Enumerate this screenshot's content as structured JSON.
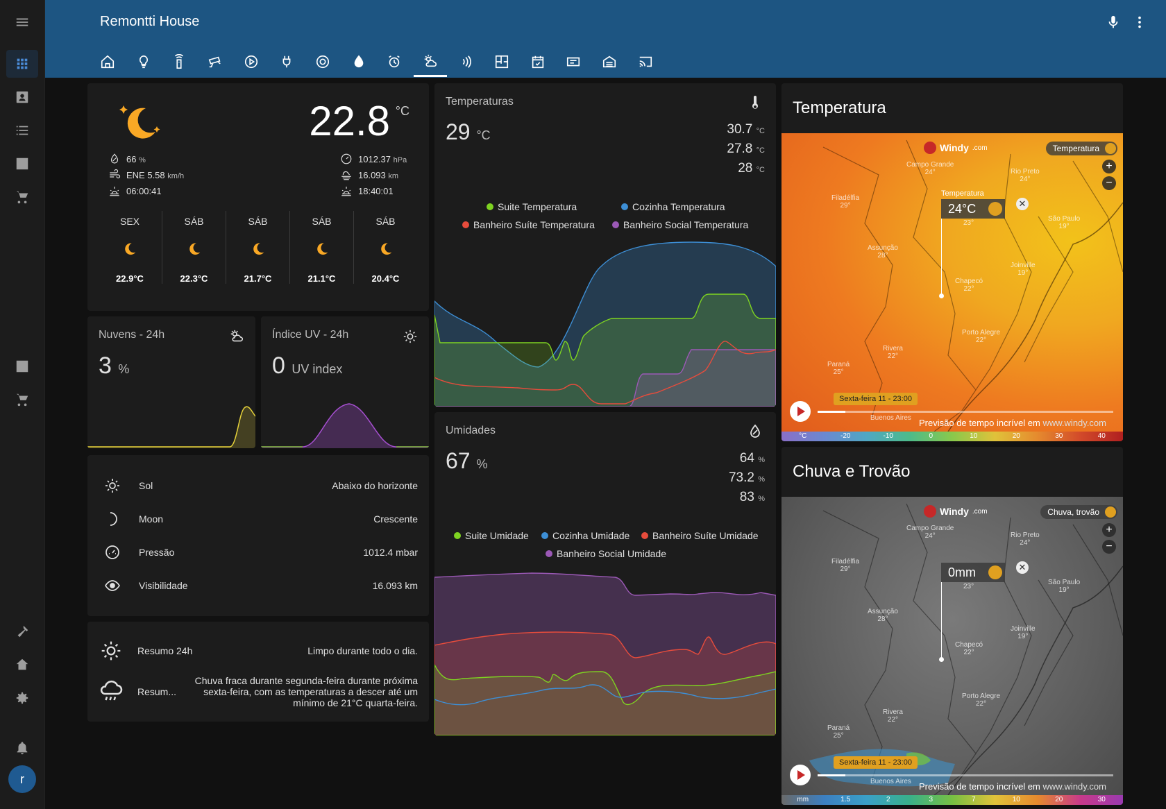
{
  "app": {
    "title": "Remontti House",
    "user_initial": "r"
  },
  "sidebar": {
    "items": [
      {
        "icon": "menu-icon"
      },
      {
        "icon": "dashboard-icon"
      },
      {
        "icon": "contact-icon"
      },
      {
        "icon": "list-icon"
      },
      {
        "icon": "chart-icon"
      },
      {
        "icon": "cart-icon"
      },
      {
        "icon": "chart-icon"
      },
      {
        "icon": "cart-icon"
      },
      {
        "icon": "hammer-icon"
      },
      {
        "icon": "home-icon"
      },
      {
        "icon": "gear-icon"
      },
      {
        "icon": "bell-icon"
      }
    ]
  },
  "header": {
    "tabs": [
      "home-tab",
      "lightbulb-tab",
      "remote-tab",
      "cctv-tab",
      "play-tab",
      "plug-tab",
      "robot-vacuum-tab",
      "water-tab",
      "alarm-tab",
      "weather-tab",
      "signal-tab",
      "floorplan-tab",
      "calendar-tab",
      "media-tab",
      "garage-tab",
      "cast-tab"
    ],
    "active_tab": 9
  },
  "weather": {
    "temperature": "22.8",
    "temp_unit": "°C",
    "humidity": "66",
    "humidity_unit": "%",
    "wind": "ENE 5.58",
    "wind_unit": "km/h",
    "sunrise": "06:00:41",
    "pressure": "1012.37",
    "pressure_unit": "hPa",
    "visibility": "16.093",
    "visibility_unit": "km",
    "sunset": "18:40:01",
    "forecast": [
      {
        "day": "SEX",
        "temp": "22.9°C"
      },
      {
        "day": "SÁB",
        "temp": "22.3°C"
      },
      {
        "day": "SÁB",
        "temp": "21.7°C"
      },
      {
        "day": "SÁB",
        "temp": "21.1°C"
      },
      {
        "day": "SÁB",
        "temp": "20.4°C"
      }
    ]
  },
  "clouds": {
    "title": "Nuvens - 24h",
    "value": "3",
    "unit": "%",
    "color": "#e6d23a"
  },
  "uv": {
    "title": "Índice UV - 24h",
    "value": "0",
    "unit": "UV index",
    "color": "#a64fd1"
  },
  "entities": [
    {
      "name": "Sol",
      "value": "Abaixo do horizonte",
      "icon": "sun-icon"
    },
    {
      "name": "Moon",
      "value": "Crescente",
      "icon": "moon-icon"
    },
    {
      "name": "Pressão",
      "value": "1012.4 mbar",
      "icon": "gauge-icon"
    },
    {
      "name": "Visibilidade",
      "value": "16.093 km",
      "icon": "eye-icon"
    }
  ],
  "summary": [
    {
      "name": "Resumo 24h",
      "value": "Limpo durante todo o dia.",
      "icon": "weather-sunny-alert-icon"
    },
    {
      "name": "Resum...",
      "value": "Chuva fraca durante segunda-feira durante próxima sexta-feira, com as temperaturas a descer até um mínimo de 21°C quarta-feira.",
      "icon": "weather-rainy-icon"
    }
  ],
  "temperatures": {
    "title": "Temperaturas",
    "value": "29",
    "unit": "°C",
    "side": [
      {
        "v": "30.7",
        "u": "°C"
      },
      {
        "v": "27.8",
        "u": "°C"
      },
      {
        "v": "28",
        "u": "°C"
      }
    ],
    "legend": [
      {
        "name": "Suite Temperatura",
        "color": "#7ed321"
      },
      {
        "name": "Cozinha Temperatura",
        "color": "#3d8fd6"
      },
      {
        "name": "Banheiro Suíte Temperatura",
        "color": "#e74c3c"
      },
      {
        "name": "Banheiro Social Temperatura",
        "color": "#9b59b6"
      }
    ]
  },
  "humidities": {
    "title": "Umidades",
    "value": "67",
    "unit": "%",
    "side": [
      {
        "v": "64",
        "u": "%"
      },
      {
        "v": "73.2",
        "u": "%"
      },
      {
        "v": "83",
        "u": "%"
      }
    ],
    "legend": [
      {
        "name": "Suite Umidade",
        "color": "#7ed321"
      },
      {
        "name": "Cozinha Umidade",
        "color": "#3d8fd6"
      },
      {
        "name": "Banheiro Suíte Umidade",
        "color": "#e74c3c"
      },
      {
        "name": "Banheiro Social Umidade",
        "color": "#9b59b6"
      }
    ]
  },
  "map_temp": {
    "title": "Temperatura",
    "logo": "Windy",
    "logo_suffix": ".com",
    "layer": "Temperatura",
    "popup_label": "Temperatura",
    "popup_value": "24°C",
    "popup_sub": "23°",
    "time": "Sexta-feira 11 - 23:00",
    "credit": "Previsão de tempo incrível em",
    "credit_url": "www.windy.com",
    "scale": [
      "°C",
      "-20",
      "-10",
      "0",
      "10",
      "20",
      "30",
      "40"
    ],
    "cities": [
      {
        "n": "Campo Grande",
        "t": "24°"
      },
      {
        "n": "Rio Preto",
        "t": "24°"
      },
      {
        "n": "Filadélfia",
        "t": "29°"
      },
      {
        "n": "São Paulo",
        "t": "19°"
      },
      {
        "n": "Assunção",
        "t": "28°"
      },
      {
        "n": "Chapecó",
        "t": "22°"
      },
      {
        "n": "Joinville",
        "t": "19°"
      },
      {
        "n": "Porto Alegre",
        "t": "22°"
      },
      {
        "n": "Rivera",
        "t": "22°"
      },
      {
        "n": "Paraná",
        "t": "25°"
      },
      {
        "n": "Buenos Aires",
        "t": ""
      }
    ]
  },
  "map_rain": {
    "title": "Chuva e Trovão",
    "logo": "Windy",
    "logo_suffix": ".com",
    "layer": "Chuva, trovão",
    "popup_value": "0mm",
    "popup_sub": "23°",
    "time": "Sexta-feira 11 - 23:00",
    "credit": "Previsão de tempo incrível em",
    "credit_url": "www.windy.com",
    "scale": [
      "mm",
      "1.5",
      "2",
      "3",
      "7",
      "10",
      "20",
      "30"
    ],
    "cities": [
      {
        "n": "Campo Grande",
        "t": "24°"
      },
      {
        "n": "Rio Preto",
        "t": "24°"
      },
      {
        "n": "Filadélfia",
        "t": "29°"
      },
      {
        "n": "São Paulo",
        "t": "19°"
      },
      {
        "n": "Assunção",
        "t": "28°"
      },
      {
        "n": "Chapecó",
        "t": "22°"
      },
      {
        "n": "Joinville",
        "t": "19°"
      },
      {
        "n": "Porto Alegre",
        "t": "22°"
      },
      {
        "n": "Rivera",
        "t": "22°"
      },
      {
        "n": "Paraná",
        "t": "25°"
      },
      {
        "n": "Buenos Aires",
        "t": ""
      }
    ]
  }
}
